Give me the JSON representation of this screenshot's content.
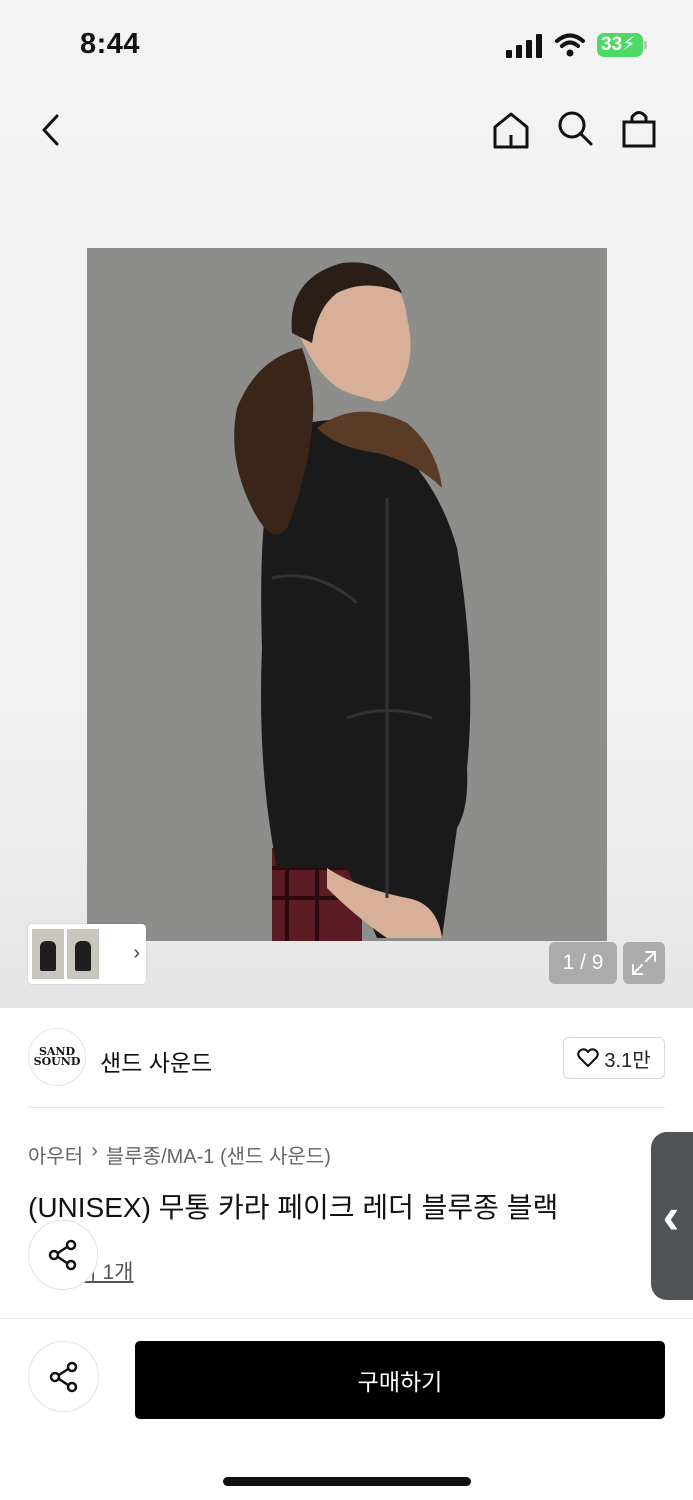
{
  "status_bar": {
    "time": "8:44",
    "battery": "33"
  },
  "nav": {
    "back_icon": "chevron-left-icon",
    "home_icon": "home-icon",
    "search_icon": "search-icon",
    "bag_icon": "shopping-bag-icon"
  },
  "gallery": {
    "page_indicator": "1 / 9",
    "expand_icon": "expand-icon"
  },
  "brand": {
    "logo_text": "SAND SOUND",
    "name": "샌드 사운드",
    "likes": "3.1만"
  },
  "product": {
    "breadcrumb": [
      "아우터",
      "블루종/MA-1 (샌드 사운드)"
    ],
    "title": "(UNISEX) 무통 카라 페이크 레더 블루종 블랙",
    "review_text": "후기 1개"
  },
  "bottom_bar": {
    "buy_label": "구매하기"
  },
  "colors": {
    "background": "#f3f3f3",
    "accent": "#000000",
    "battery": "#4cd964"
  }
}
